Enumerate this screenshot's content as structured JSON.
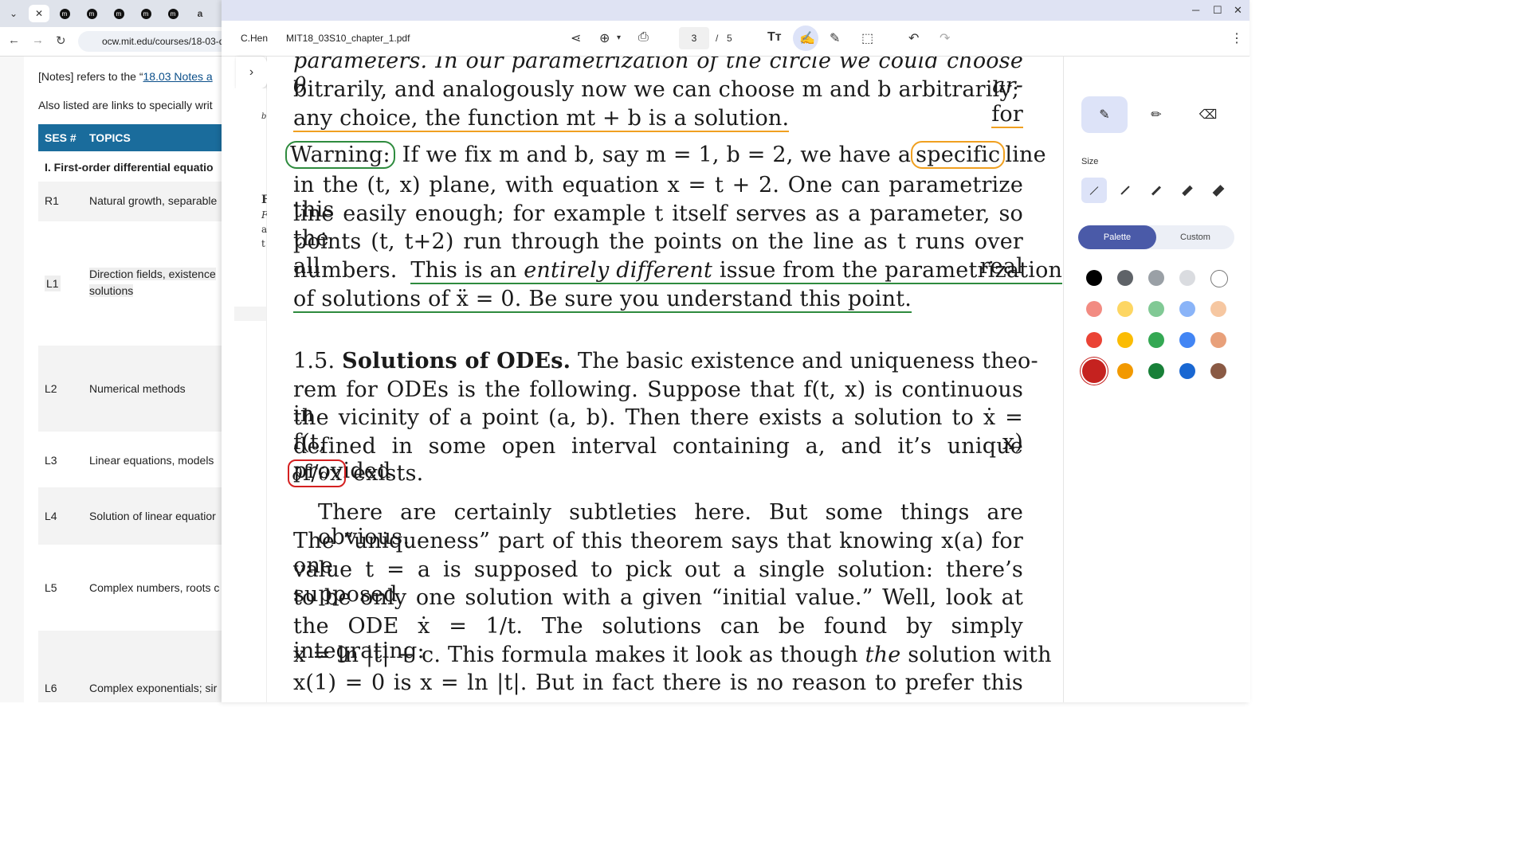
{
  "background_browser": {
    "url": "ocw.mit.edu/courses/18-03-d",
    "notes_prefix": "[Notes] refers to the “",
    "notes_link": "18.03 Notes a",
    "also_listed": "Also listed are links to specially writ",
    "table": {
      "col_ses": "SES #",
      "col_topics": "TOPICS",
      "section": "I. First-order differential equatio",
      "rows": [
        {
          "num": "R1",
          "topic": "Natural growth, separable"
        },
        {
          "num": "L1",
          "topic": "Direction fields, existence",
          "topic2": "solutions"
        },
        {
          "num": "L2",
          "topic": "Numerical methods"
        },
        {
          "num": "L3",
          "topic": "Linear equations, models"
        },
        {
          "num": "L4",
          "topic": "Solution of linear equatior"
        },
        {
          "num": "L5",
          "topic": "Complex numbers, roots c"
        },
        {
          "num": "L6",
          "topic": "Complex exponentials; sir"
        }
      ]
    }
  },
  "pdf_viewer": {
    "tab_short": "C.Hen",
    "file_name": "MIT18_03S10_chapter_1.pdf",
    "page_current": "3",
    "page_sep": "/",
    "page_total": "5",
    "document_lines": {
      "l0": "parameters. In our parametrization of the circle we could choose θ ar-",
      "l1a": "bitrarily, and analogously now we can choose m and b arbitrarily;",
      "l1b": "for",
      "l2": "any choice, the function mt + b is a solution.",
      "l3_warning": "Warning:",
      "l3a": "If we fix m and b, say m = 1, b = 2, we have a",
      "l3_specific": "specific",
      "l3b": "line",
      "l4": "in the (t, x) plane, with equation x = t + 2. One can parametrize this",
      "l5": "line easily enough; for example t itself serves as a parameter, so the",
      "l6": "points (t, t+2) run through the points on the line as t runs over all real",
      "l7a": "numbers.",
      "l7b": "This is an",
      "l7c": "entirely different",
      "l7d": "issue from the parametrization",
      "l8": "of solutions of ẍ = 0. Be sure you understand this point.",
      "l9_num": "1.5.",
      "l9_head": "Solutions of ODEs.",
      "l9_rest": "The basic existence and uniqueness theo-",
      "l10": "rem for ODEs is the following. Suppose that f(t, x) is continuous in",
      "l11": "the vicinity of a point (a, b). Then there exists a solution to ẋ = f(t, x)",
      "l12": "defined in some open interval containing a, and it’s unique provided",
      "l13_box": "∂f/∂x",
      "l13_rest": "exists.",
      "l14": "There are certainly subtleties here. But some things are obvious.",
      "l15": "The “uniqueness” part of this theorem says that knowing x(a) for one",
      "l16": "value t = a is supposed to pick out a single solution: there’s supposed",
      "l17": "to be only one solution with a given “initial value.” Well, look at",
      "l18": "the ODE ẋ = 1/t. The solutions can be found by simply integrating:",
      "l19a": "x = ln |t| + c. This formula makes it look as though",
      "l19b": "the",
      "l19c": "solution with",
      "l20": "x(1) = 0 is x = ln |t|. But in fact there is no reason to prefer this"
    }
  },
  "annotation_panel": {
    "size_label": "Size",
    "tab_palette": "Palette",
    "tab_custom": "Custom",
    "colors": {
      "ink_orange": "#f0a020",
      "ink_green": "#2e8b3e",
      "ink_red": "#d42020",
      "accent": "#4a5aa8"
    },
    "palette": [
      [
        "#000000",
        "#5f6368",
        "#9aa0a6",
        "#dadce0",
        "#ffffff"
      ],
      [
        "#f28b82",
        "#fdd663",
        "#81c995",
        "#8ab4f8",
        "#f6c7a1"
      ],
      [
        "#ea4335",
        "#fbbc04",
        "#34a853",
        "#4285f4",
        "#e8a07a"
      ],
      [
        "#c5221f",
        "#f29900",
        "#188038",
        "#1967d2",
        "#8a5a44"
      ]
    ]
  }
}
